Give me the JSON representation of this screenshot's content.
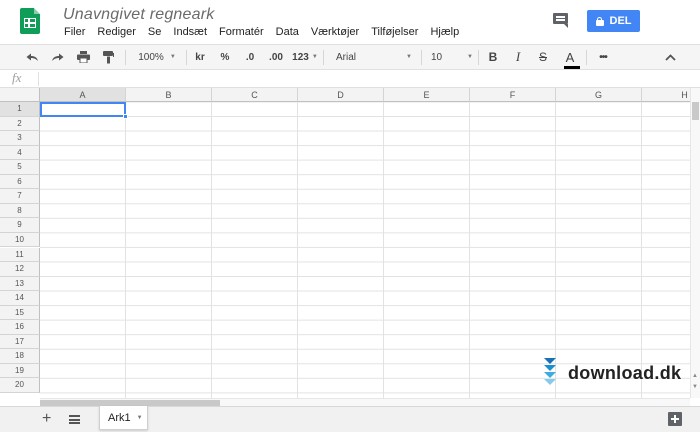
{
  "header": {
    "title": "Unavngivet regneark",
    "menu": [
      "Filer",
      "Rediger",
      "Se",
      "Indsæt",
      "Formatér",
      "Data",
      "Værktøjer",
      "Tilføjelser",
      "Hjælp"
    ],
    "share_label": "DEL"
  },
  "toolbar": {
    "zoom": "100%",
    "currency": "kr",
    "percent": "%",
    "decimal_decrease": ".0",
    "decimal_increase": ".00",
    "more_formats": "123",
    "font": "Arial",
    "font_size": "10",
    "bold": "B",
    "italic": "I",
    "strikethrough": "S",
    "text_color": "A",
    "more": "•••"
  },
  "formula_bar": {
    "fx_label": "fx",
    "value": ""
  },
  "grid": {
    "columns": [
      "A",
      "B",
      "C",
      "D",
      "E",
      "F",
      "G",
      "H"
    ],
    "rows": [
      "1",
      "2",
      "3",
      "4",
      "5",
      "6",
      "7",
      "8",
      "9",
      "10",
      "11",
      "12",
      "13",
      "14",
      "15",
      "16",
      "17",
      "18",
      "19",
      "20"
    ],
    "selected_cell": "A1"
  },
  "sheets": {
    "tabs": [
      "Ark1"
    ]
  },
  "watermark": {
    "text": "download.dk"
  },
  "colors": {
    "accent": "#4285f4",
    "brand": "#0f9d58"
  }
}
